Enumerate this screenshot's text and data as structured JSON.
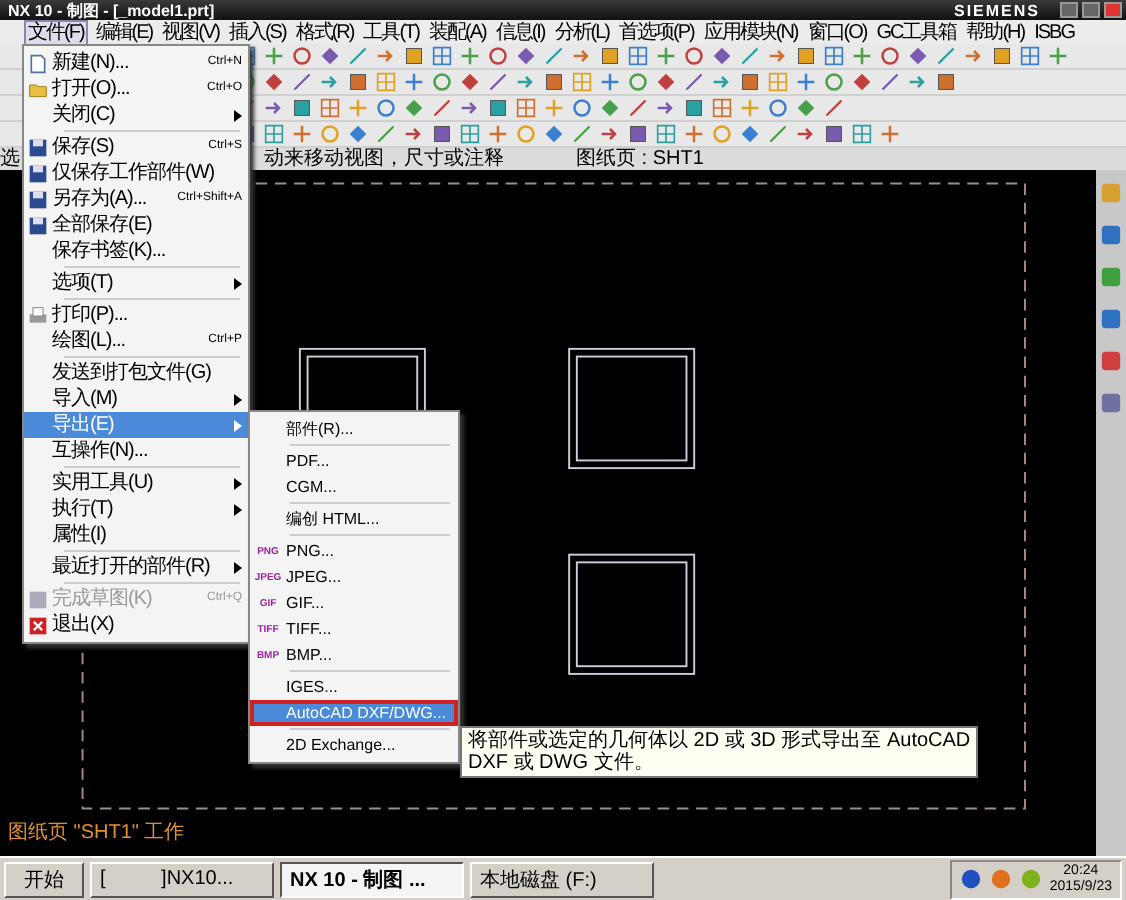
{
  "window": {
    "title": "NX 10 - 制图 - [_model1.prt]",
    "brand": "SIEMENS"
  },
  "menu_bar": [
    {
      "label": "文件(F)",
      "selected": true
    },
    {
      "label": "编辑(E)",
      "selected": false
    },
    {
      "label": "视图(V)",
      "selected": false
    },
    {
      "label": "插入(S)",
      "selected": false
    },
    {
      "label": "格式(R)",
      "selected": false
    },
    {
      "label": "工具(T)",
      "selected": false
    },
    {
      "label": "装配(A)",
      "selected": false
    },
    {
      "label": "信息(I)",
      "selected": false
    },
    {
      "label": "分析(L)",
      "selected": false
    },
    {
      "label": "首选项(P)",
      "selected": false
    },
    {
      "label": "应用模块(N)",
      "selected": false
    },
    {
      "label": "窗口(O)",
      "selected": false
    },
    {
      "label": "GC工具箱",
      "selected": false
    },
    {
      "label": "帮助(H)",
      "selected": false
    },
    {
      "label": "ISBG",
      "selected": false
    }
  ],
  "status_line": {
    "left": "选",
    "prompt": "动来移动视图，尺寸或注释",
    "sheet": "图纸页 : SHT1"
  },
  "file_menu": [
    {
      "kind": "item",
      "label": "新建(N)...",
      "shortcut": "Ctrl+N",
      "submenu": false,
      "selected": false,
      "disabled": false
    },
    {
      "kind": "item",
      "label": "打开(O)...",
      "shortcut": "Ctrl+O",
      "submenu": false,
      "selected": false,
      "disabled": false
    },
    {
      "kind": "item",
      "label": "关闭(C)",
      "submenu": true,
      "selected": false,
      "disabled": false
    },
    {
      "kind": "separator"
    },
    {
      "kind": "item",
      "label": "保存(S)",
      "shortcut": "Ctrl+S",
      "submenu": false,
      "selected": false,
      "disabled": false
    },
    {
      "kind": "item",
      "label": "仅保存工作部件(W)",
      "submenu": false,
      "selected": false,
      "disabled": false
    },
    {
      "kind": "item",
      "label": "另存为(A)...",
      "shortcut": "Ctrl+Shift+A",
      "submenu": false,
      "selected": false,
      "disabled": false
    },
    {
      "kind": "item",
      "label": "全部保存(E)",
      "submenu": false,
      "selected": false,
      "disabled": false
    },
    {
      "kind": "item",
      "label": "保存书签(K)...",
      "submenu": false,
      "selected": false,
      "disabled": false
    },
    {
      "kind": "separator"
    },
    {
      "kind": "item",
      "label": "选项(T)",
      "submenu": true,
      "selected": false,
      "disabled": false
    },
    {
      "kind": "separator"
    },
    {
      "kind": "item",
      "label": "打印(P)...",
      "submenu": false,
      "selected": false,
      "disabled": false
    },
    {
      "kind": "item",
      "label": "绘图(L)...",
      "shortcut": "Ctrl+P",
      "submenu": false,
      "selected": false,
      "disabled": false
    },
    {
      "kind": "separator"
    },
    {
      "kind": "item",
      "label": "发送到打包文件(G)",
      "submenu": false,
      "selected": false,
      "disabled": false
    },
    {
      "kind": "item",
      "label": "导入(M)",
      "submenu": true,
      "selected": false,
      "disabled": false
    },
    {
      "kind": "item",
      "label": "导出(E)",
      "submenu": true,
      "selected": true,
      "disabled": false
    },
    {
      "kind": "item",
      "label": "互操作(N)...",
      "submenu": false,
      "selected": false,
      "disabled": false
    },
    {
      "kind": "separator"
    },
    {
      "kind": "item",
      "label": "实用工具(U)",
      "submenu": true,
      "selected": false,
      "disabled": false
    },
    {
      "kind": "item",
      "label": "执行(T)",
      "submenu": true,
      "selected": false,
      "disabled": false
    },
    {
      "kind": "item",
      "label": "属性(I)",
      "submenu": false,
      "selected": false,
      "disabled": false
    },
    {
      "kind": "separator"
    },
    {
      "kind": "item",
      "label": "最近打开的部件(R)",
      "submenu": true,
      "selected": false,
      "disabled": false
    },
    {
      "kind": "separator"
    },
    {
      "kind": "item",
      "label": "完成草图(K)",
      "shortcut": "Ctrl+Q",
      "submenu": false,
      "selected": false,
      "disabled": true
    },
    {
      "kind": "item",
      "label": "退出(X)",
      "submenu": false,
      "selected": false,
      "disabled": false
    }
  ],
  "export_submenu": [
    {
      "kind": "item",
      "label": "部件(R)...",
      "selected": false
    },
    {
      "kind": "separator"
    },
    {
      "kind": "item",
      "label": "PDF...",
      "selected": false
    },
    {
      "kind": "item",
      "label": "CGM...",
      "selected": false
    },
    {
      "kind": "separator"
    },
    {
      "kind": "item",
      "label": "编创 HTML...",
      "selected": false
    },
    {
      "kind": "separator"
    },
    {
      "kind": "item",
      "label": "PNG...",
      "badge": "PNG",
      "selected": false
    },
    {
      "kind": "item",
      "label": "JPEG...",
      "badge": "JPEG",
      "selected": false
    },
    {
      "kind": "item",
      "label": "GIF...",
      "badge": "GIF",
      "selected": false
    },
    {
      "kind": "item",
      "label": "TIFF...",
      "badge": "TIFF",
      "selected": false
    },
    {
      "kind": "item",
      "label": "BMP...",
      "badge": "BMP",
      "selected": false
    },
    {
      "kind": "separator"
    },
    {
      "kind": "item",
      "label": "IGES...",
      "selected": false
    },
    {
      "kind": "item",
      "label": "AutoCAD DXF/DWG...",
      "selected": true
    },
    {
      "kind": "separator"
    },
    {
      "kind": "item",
      "label": "2D Exchange...",
      "selected": false
    }
  ],
  "tooltip": {
    "lines": [
      "将部件或选定的几何体以 2D 或 3D 形式导出至 AutoCAD",
      "DXF 或 DWG 文件。"
    ]
  },
  "sheet_status": "图纸页 \"SHT1\" 工作",
  "taskbar": {
    "start": "开始",
    "buttons": [
      {
        "label": "[          ]NX10...",
        "selected": false
      },
      {
        "label": "NX 10 - 制图 ...",
        "selected": true
      },
      {
        "label": "本地磁盘 (F:)",
        "selected": false
      }
    ],
    "time": "20:24",
    "date": "2015/9/23"
  }
}
